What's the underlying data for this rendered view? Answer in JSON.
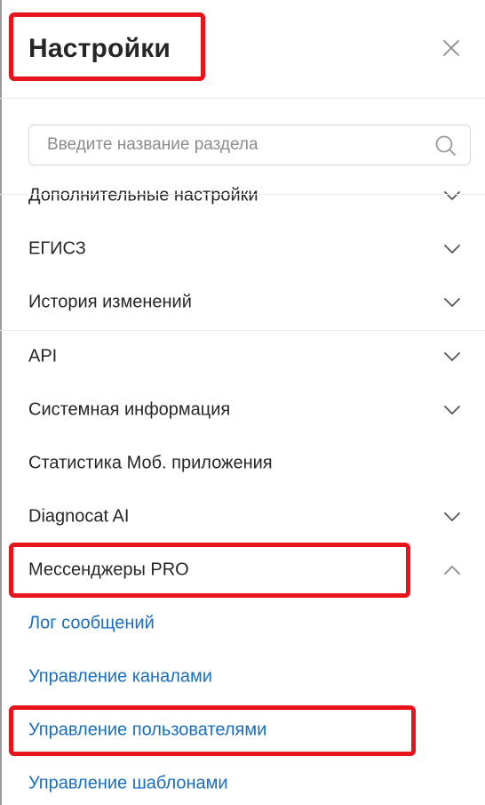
{
  "header": {
    "title": "Настройки",
    "close_icon": "close-icon"
  },
  "search": {
    "placeholder": "Введите название раздела",
    "value": "",
    "icon": "search-icon"
  },
  "menu": {
    "items": [
      {
        "label": "Дополнительные настройки",
        "expanded": false,
        "has_chevron": true
      },
      {
        "label": "ЕГИСЗ",
        "expanded": false,
        "has_chevron": true
      },
      {
        "label": "История изменений",
        "expanded": false,
        "has_chevron": true
      },
      {
        "label": "API",
        "expanded": false,
        "has_chevron": true
      },
      {
        "label": "Системная информация",
        "expanded": false,
        "has_chevron": true
      },
      {
        "label": "Статистика Моб. приложения",
        "expanded": false,
        "has_chevron": false
      },
      {
        "label": "Diagnocat AI",
        "expanded": false,
        "has_chevron": true
      },
      {
        "label": "Мессенджеры PRO",
        "expanded": true,
        "has_chevron": true
      }
    ],
    "subitems": [
      {
        "label": "Лог сообщений"
      },
      {
        "label": "Управление каналами"
      },
      {
        "label": "Управление пользователями"
      },
      {
        "label": "Управление шаблонами"
      }
    ]
  },
  "colors": {
    "text": "#262626",
    "link": "#1a6ec2",
    "highlight": "#e8141b",
    "icon": "#8c8c8c"
  }
}
